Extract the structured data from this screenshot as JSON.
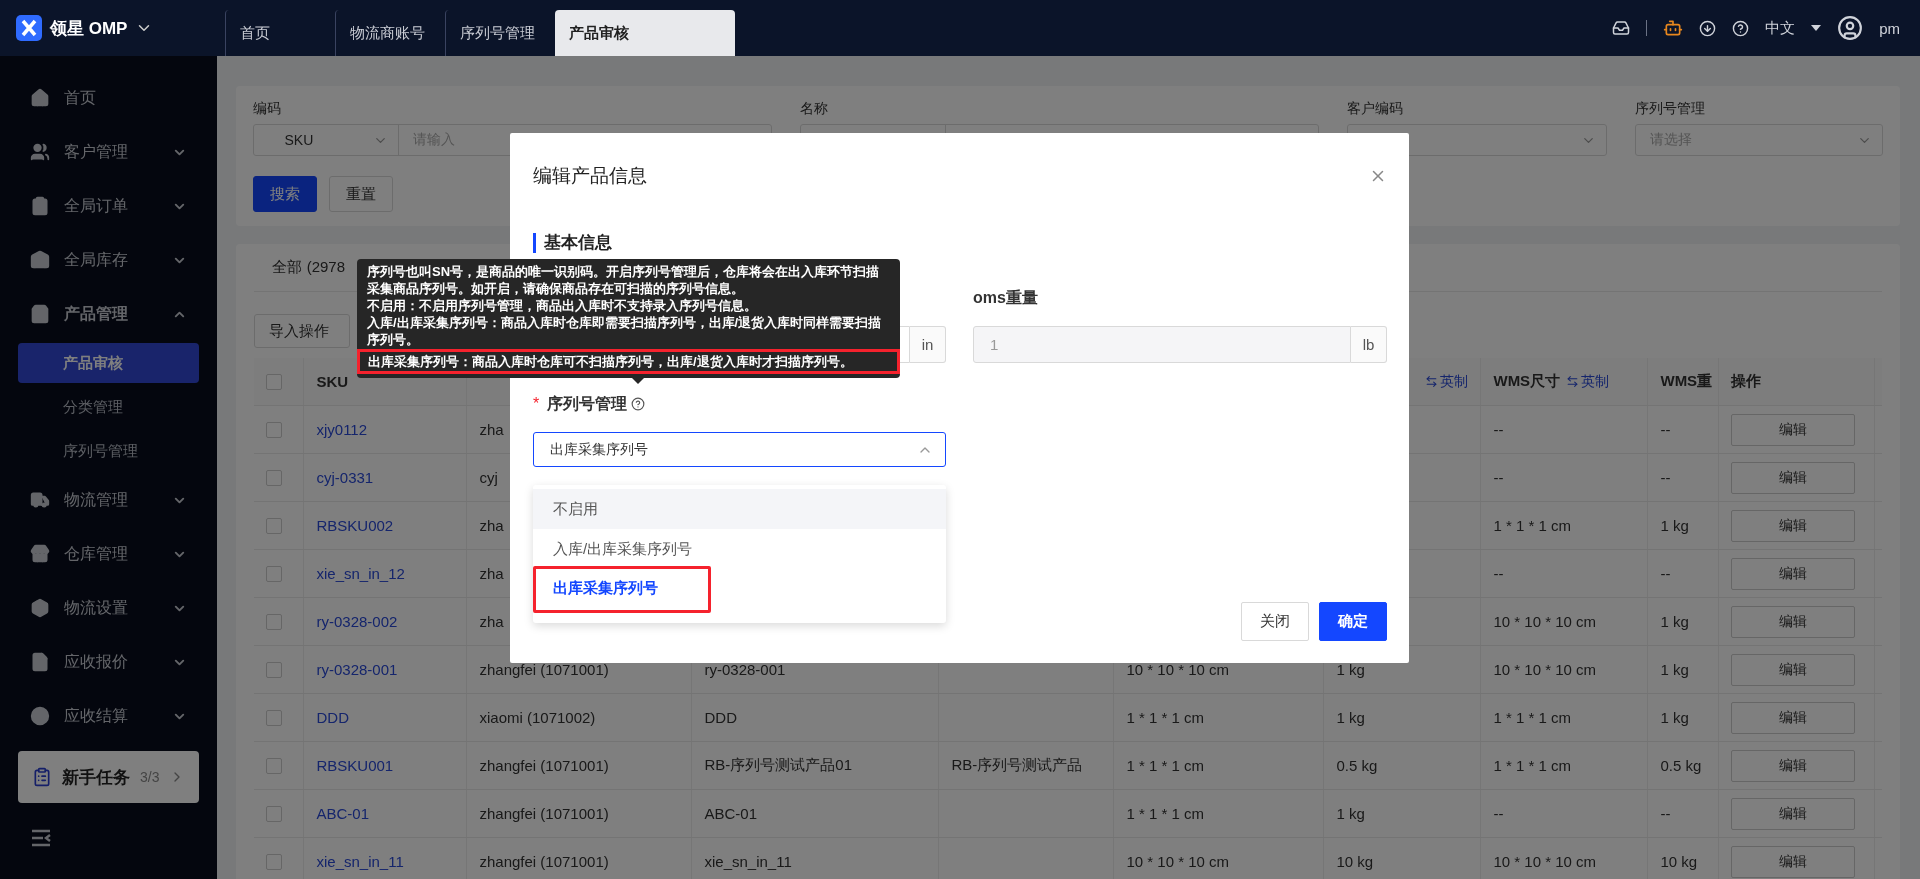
{
  "app": {
    "brand": "领星 OMP"
  },
  "top_tabs": [
    {
      "label": "首页",
      "selected": false
    },
    {
      "label": "物流商账号",
      "selected": false
    },
    {
      "label": "序列号管理",
      "selected": false
    },
    {
      "label": "产品审核",
      "selected": true
    }
  ],
  "header_right": {
    "language": "中文",
    "user": "pm"
  },
  "sidebar": {
    "items": [
      {
        "label": "首页"
      },
      {
        "label": "客户管理",
        "expanded": false
      },
      {
        "label": "全局订单",
        "expanded": false
      },
      {
        "label": "全局库存",
        "expanded": false
      },
      {
        "label": "产品管理",
        "expanded": true,
        "children": [
          {
            "label": "产品审核",
            "selected": true
          },
          {
            "label": "分类管理",
            "selected": false
          },
          {
            "label": "序列号管理",
            "selected": false
          }
        ]
      },
      {
        "label": "物流管理",
        "expanded": false
      },
      {
        "label": "仓库管理",
        "expanded": false
      },
      {
        "label": "物流设置",
        "expanded": false
      },
      {
        "label": "应收报价",
        "expanded": false
      },
      {
        "label": "应收结算",
        "expanded": false
      }
    ],
    "task_card": {
      "title": "新手任务",
      "count": "3/3"
    }
  },
  "filters": [
    {
      "label": "编码",
      "kind": "select-input",
      "select": "SKU",
      "placeholder": "请输入"
    },
    {
      "label": "名称",
      "kind": "select-input"
    },
    {
      "label": "客户编码",
      "kind": "select"
    },
    {
      "label": "序列号管理",
      "kind": "select",
      "placeholder": "请选择"
    }
  ],
  "filter_buttons": [
    {
      "label": "搜索",
      "kind": "primary"
    },
    {
      "label": "重置",
      "kind": "default"
    }
  ],
  "status_tab": "全部 (2978",
  "import_button": "导入操作",
  "table": {
    "header_checked": false,
    "columns": [
      {
        "label": "SKU"
      },
      {},
      {},
      {},
      {},
      {
        "link": "英制"
      },
      {
        "label": "WMS尺寸",
        "link": "英制"
      },
      {
        "label": "WMS重"
      },
      {
        "label": "操作"
      }
    ],
    "rows": [
      {
        "checked": false,
        "sku": "xjy0112",
        "customer": "zha",
        "wms_size": "--",
        "wms_weight": "--",
        "action": "编辑"
      },
      {
        "checked": false,
        "sku": "cyj-0331",
        "customer": "cyj",
        "wms_size": "--",
        "wms_weight": "--",
        "action": "编辑"
      },
      {
        "checked": false,
        "sku": "RBSKU002",
        "customer": "zha",
        "wms_size": "1 * 1 * 1 cm",
        "wms_weight": "1 kg",
        "action": "编辑"
      },
      {
        "checked": false,
        "sku": "xie_sn_in_12",
        "customer": "zha",
        "wms_size": "--",
        "wms_weight": "--",
        "action": "编辑"
      },
      {
        "checked": false,
        "sku": "ry-0328-002",
        "customer": "zha",
        "wms_size": "10 * 10 * 10 cm",
        "wms_weight": "1 kg",
        "action": "编辑"
      },
      {
        "checked": false,
        "sku": "ry-0328-001",
        "customer": "zhangfei (1071001)",
        "name": "ry-0328-001",
        "size": "10 * 10 * 10 cm",
        "weight": "1 kg",
        "wms_size": "10 * 10 * 10 cm",
        "wms_weight": "1 kg",
        "action": "编辑"
      },
      {
        "checked": false,
        "sku": "DDD",
        "customer": "xiaomi (1071002)",
        "name": "DDD",
        "size": "1 * 1 * 1 cm",
        "weight": "1 kg",
        "wms_size": "1 * 1 * 1 cm",
        "wms_weight": "1 kg",
        "action": "编辑"
      },
      {
        "checked": false,
        "sku": "RBSKU001",
        "customer": "zhangfei (1071001)",
        "name": "RB-序列号测试产品01",
        "column_4": "RB-序列号测试产品",
        "size": "1 * 1 * 1 cm",
        "weight": "0.5 kg",
        "wms_size": "1 * 1 * 1 cm",
        "wms_weight": "0.5 kg",
        "action": "编辑"
      },
      {
        "checked": false,
        "sku": "ABC-01",
        "customer": "zhangfei (1071001)",
        "name": "ABC-01",
        "size": "1 * 1 * 1 cm",
        "weight": "1 kg",
        "wms_size": "--",
        "wms_weight": "--",
        "action": "编辑"
      },
      {
        "checked": false,
        "sku": "xie_sn_in_11",
        "customer": "zhangfei (1071001)",
        "name": "xie_sn_in_11",
        "size": "10 * 10 * 10 cm",
        "weight": "10 kg",
        "wms_size": "10 * 10 * 10 cm",
        "wms_weight": "10 kg",
        "action": "编辑"
      }
    ]
  },
  "modal": {
    "title": "编辑产品信息",
    "section": "基本信息",
    "dims_field": {
      "unit": "in"
    },
    "weight_field": {
      "label": "oms重量",
      "value": "1",
      "unit": "lb",
      "disabled": true
    },
    "serial": {
      "label": "序列号管理",
      "required_mark": "*",
      "value": "出库采集序列号",
      "open": true,
      "options": [
        {
          "label": "不启用",
          "hovered": true,
          "selected": false,
          "highlighted": false
        },
        {
          "label": "入库/出库采集序列号",
          "hovered": false,
          "selected": false,
          "highlighted": false
        },
        {
          "label": "出库采集序列号",
          "hovered": false,
          "selected": true,
          "highlighted": true
        }
      ]
    },
    "buttons": [
      {
        "label": "关闭",
        "kind": "default"
      },
      {
        "label": "确定",
        "kind": "primary"
      }
    ]
  },
  "tooltip": {
    "paragraphs": [
      {
        "text": "序列号也叫SN号，是商品的唯一识别码。开启序列号管理后，仓库将会在出入库环节扫描采集商品序列号。如开启，请确保商品存在可扫描的序列号信息。",
        "highlighted": false
      },
      {
        "text": "不启用：不启用序列号管理，商品出入库时不支持录入序列号信息。",
        "highlighted": false
      },
      {
        "text": "入库/出库采集序列号：商品入库时仓库即需要扫描序列号，出库/退货入库时同样需要扫描序列号。",
        "highlighted": false
      },
      {
        "text": "出库采集序列号：商品入库时仓库可不扫描序列号，出库/退货入库时才扫描序列号。",
        "highlighted": true
      }
    ]
  }
}
